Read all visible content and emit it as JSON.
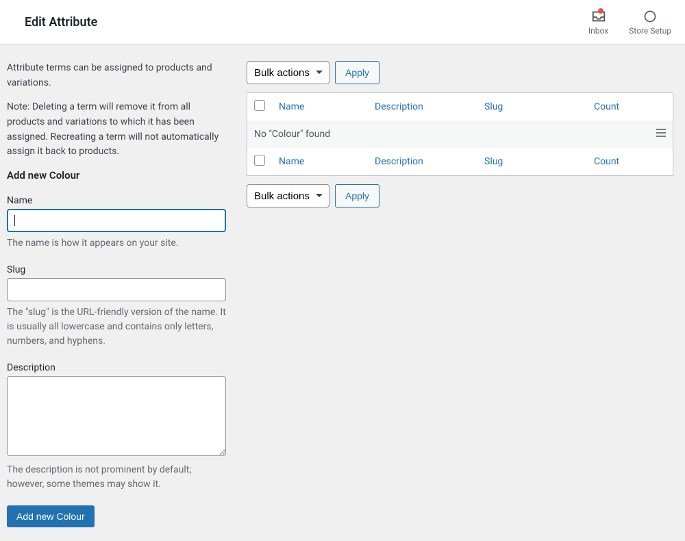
{
  "topbar": {
    "title": "Edit Attribute",
    "inbox_label": "Inbox",
    "store_setup_label": "Store Setup"
  },
  "intro": {
    "p1": "Attribute terms can be assigned to products and variations.",
    "p2": "Note: Deleting a term will remove it from all products and variations to which it has been assigned. Recreating a term will not automatically assign it back to products."
  },
  "form": {
    "section_title": "Add new Colour",
    "name_label": "Name",
    "name_value": "",
    "name_help": "The name is how it appears on your site.",
    "slug_label": "Slug",
    "slug_value": "",
    "slug_help": "The \"slug\" is the URL-friendly version of the name. It is usually all lowercase and contains only letters, numbers, and hyphens.",
    "description_label": "Description",
    "description_value": "",
    "description_help": "The description is not prominent by default; however, some themes may show it.",
    "submit_label": "Add new Colour"
  },
  "bulk": {
    "select_label": "Bulk actions",
    "apply_label": "Apply"
  },
  "table": {
    "col_name": "Name",
    "col_description": "Description",
    "col_slug": "Slug",
    "col_count": "Count",
    "empty_msg": "No \"Colour\" found"
  }
}
